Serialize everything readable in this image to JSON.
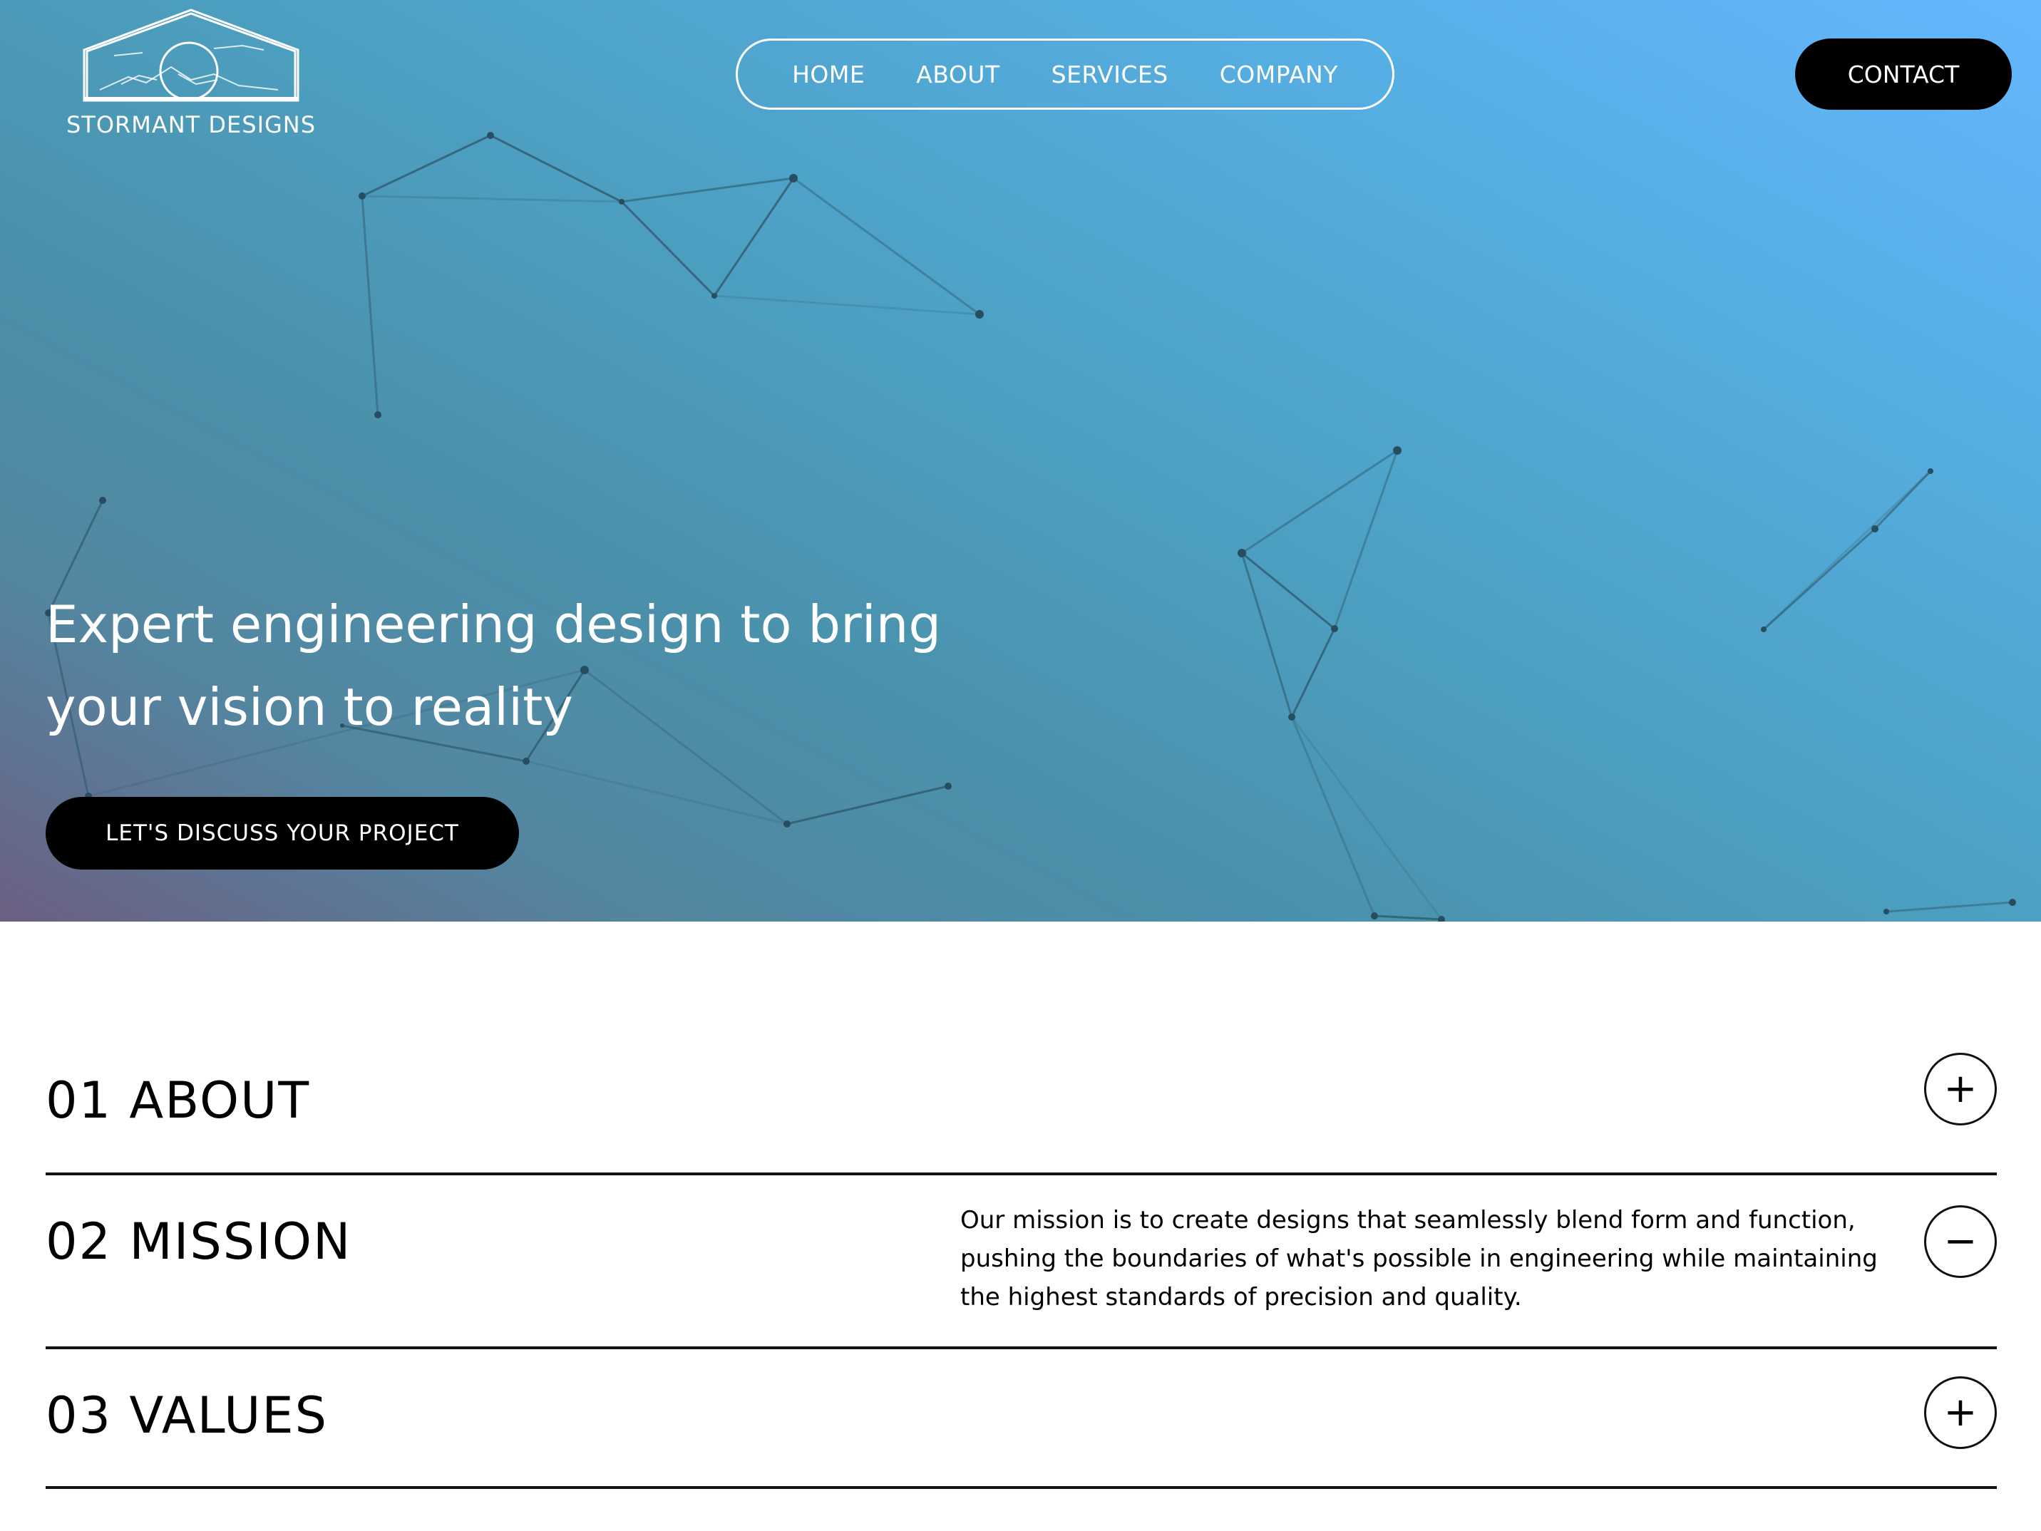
{
  "brand": {
    "name": "STORMANT DESIGNS",
    "logo_icon": "mountain-house-logo"
  },
  "nav": {
    "items": [
      {
        "label": "HOME"
      },
      {
        "label": "ABOUT"
      },
      {
        "label": "SERVICES"
      },
      {
        "label": "COMPANY"
      }
    ],
    "contact_label": "CONTACT"
  },
  "hero": {
    "headline": "Expert engineering design to bring your vision to reality",
    "cta_label": "LET'S DISCUSS YOUR PROJECT",
    "colors": {
      "gradient_light": "#65b6fd",
      "gradient_mid": "#4da1c4",
      "gradient_dark": "#6c5f82",
      "network_line": "#2f5a6e"
    }
  },
  "sections": [
    {
      "title": "01 ABOUT",
      "toggle_icon": "plus-icon",
      "toggle_symbol": "+",
      "expanded": false,
      "body": ""
    },
    {
      "title": "02 MISSION",
      "toggle_icon": "minus-icon",
      "toggle_symbol": "−",
      "expanded": true,
      "body": "Our mission is to create designs that seamlessly blend form and function, pushing the boundaries of what's possible in engineering while maintaining the highest standards of precision and quality."
    },
    {
      "title": "03 VALUES",
      "toggle_icon": "plus-icon",
      "toggle_symbol": "+",
      "expanded": false,
      "body": ""
    }
  ]
}
